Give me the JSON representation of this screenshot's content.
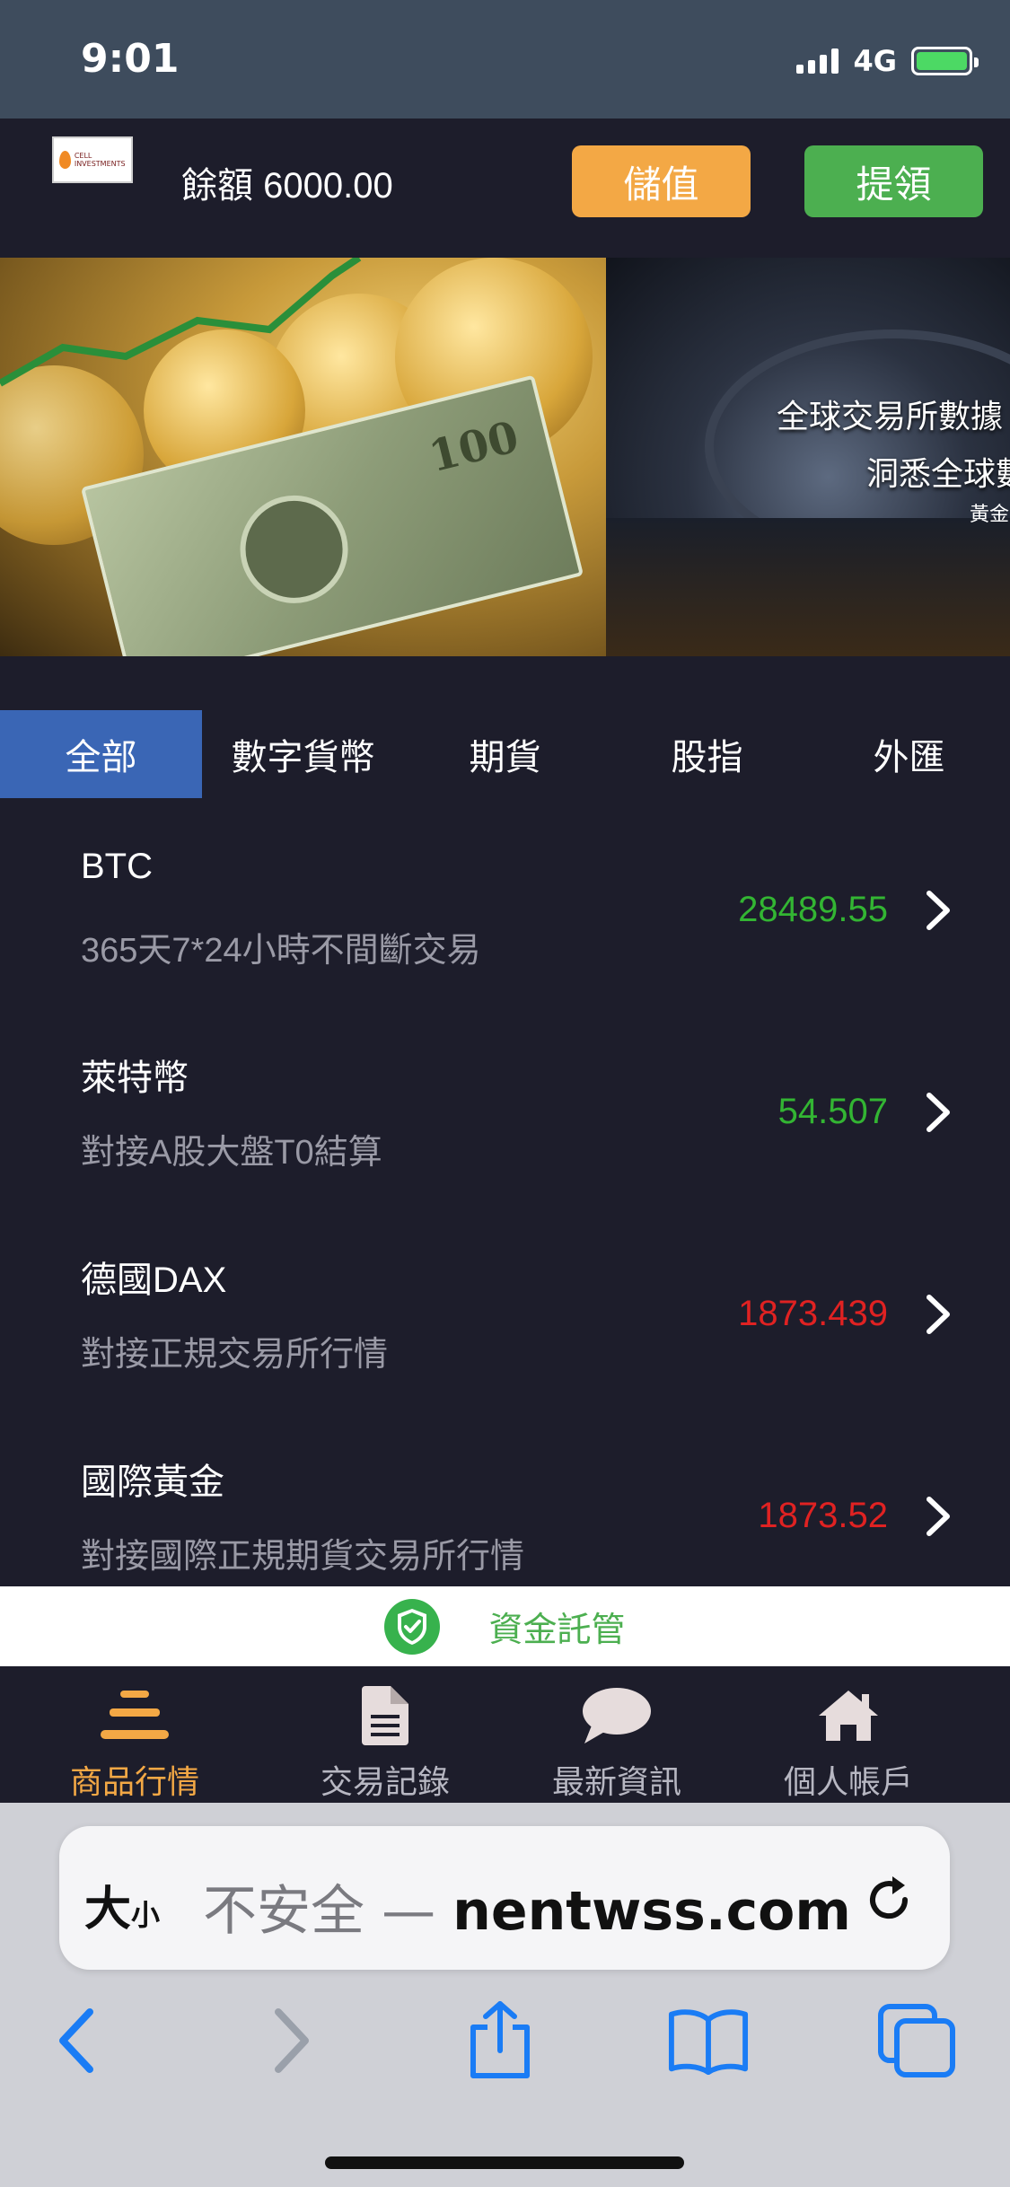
{
  "status_bar": {
    "time": "9:01",
    "network": "4G"
  },
  "header": {
    "logo_text": "CELL INVESTMENTS",
    "balance": "餘額 6000.00",
    "deposit_label": "儲值",
    "withdraw_label": "提領"
  },
  "banner": {
    "line1": "全球交易所數據",
    "line2": "洞悉全球數",
    "line3": "黃金",
    "bill_number": "100"
  },
  "tabs": [
    {
      "label": "全部",
      "active": true
    },
    {
      "label": "數字貨幣",
      "active": false
    },
    {
      "label": "期貨",
      "active": false
    },
    {
      "label": "股指",
      "active": false
    },
    {
      "label": "外匯",
      "active": false
    }
  ],
  "products": [
    {
      "name": "BTC",
      "desc": "365天7*24小時不間斷交易",
      "price": "28489.55",
      "trend": "up",
      "trend_color": "#33b533"
    },
    {
      "name": "萊特幣",
      "desc": "對接A股大盤T0結算",
      "price": "54.507",
      "trend": "up",
      "trend_color": "#33b533"
    },
    {
      "name": "德國DAX",
      "desc": "對接正規交易所行情",
      "price": "1873.439",
      "trend": "down",
      "trend_color": "#e02222"
    },
    {
      "name": "國際黃金",
      "desc": "對接國際正規期貨交易所行情",
      "price": "1873.52",
      "trend": "down",
      "trend_color": "#e02222"
    }
  ],
  "custody": {
    "label": "資金託管"
  },
  "bottom_nav": [
    {
      "label": "商品行情",
      "icon": "market-icon",
      "active": true
    },
    {
      "label": "交易記錄",
      "icon": "document-icon",
      "active": false
    },
    {
      "label": "最新資訊",
      "icon": "chat-bubble-icon",
      "active": false
    },
    {
      "label": "個人帳戶",
      "icon": "home-icon",
      "active": false
    }
  ],
  "browser": {
    "text_size_label": "大",
    "text_size_small": "小",
    "url_prefix": "不安全 — ",
    "url_domain": "nentwss.com"
  },
  "colors": {
    "accent_orange": "#f3a845",
    "accent_green": "#4caf50",
    "tab_active": "#3a66b5",
    "background": "#1d1d2b",
    "safari_blue": "#1a7cf5"
  }
}
